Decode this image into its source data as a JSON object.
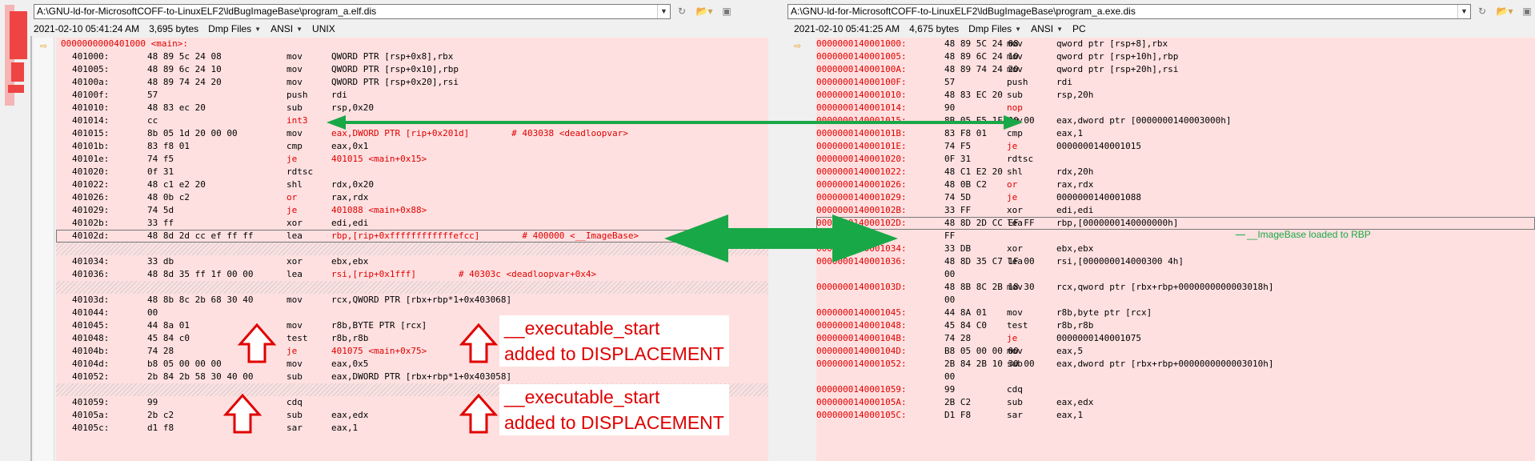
{
  "left": {
    "path": "A:\\GNU-ld-for-MicrosoftCOFF-to-LinuxELF2\\ldBugImageBase\\program_a.elf.dis",
    "date": "2021-02-10 05:41:24 AM",
    "size": "3,695 bytes",
    "filter": "Dmp Files",
    "encoding": "ANSI",
    "eol": "UNIX",
    "header": "0000000000401000 <main>:",
    "lines": [
      [
        "401000:",
        "48 89 5c 24 08",
        "mov",
        "QWORD PTR [rsp+0x8],rbx"
      ],
      [
        "401005:",
        "48 89 6c 24 10",
        "mov",
        "QWORD PTR [rsp+0x10],rbp"
      ],
      [
        "40100a:",
        "48 89 74 24 20",
        "mov",
        "QWORD PTR [rsp+0x20],rsi"
      ],
      [
        "40100f:",
        "57",
        "push",
        "rdi"
      ],
      [
        "401010:",
        "48 83 ec 20",
        "sub",
        "rsp,0x20"
      ],
      [
        "401014:",
        "cc",
        "int3",
        ""
      ],
      [
        "401015:",
        "8b 05 1d 20 00 00",
        "mov",
        "eax,DWORD PTR [rip+0x201d]        # 403038 <deadloopvar>"
      ],
      [
        "40101b:",
        "83 f8 01",
        "cmp",
        "eax,0x1"
      ],
      [
        "40101e:",
        "74 f5",
        "je",
        "401015 <main+0x15>"
      ],
      [
        "401020:",
        "0f 31",
        "rdtsc",
        ""
      ],
      [
        "401022:",
        "48 c1 e2 20",
        "shl",
        "rdx,0x20"
      ],
      [
        "401026:",
        "48 0b c2",
        "or",
        "rax,rdx"
      ],
      [
        "401029:",
        "74 5d",
        "je",
        "401088 <main+0x88>"
      ],
      [
        "40102b:",
        "33 ff",
        "xor",
        "edi,edi"
      ],
      [
        "40102d:",
        "48 8d 2d cc ef ff ff",
        "lea",
        "rbp,[rip+0xffffffffffffefcc]        # 400000 <__ImageBase>"
      ],
      [
        "",
        "",
        "",
        ""
      ],
      [
        "401034:",
        "33 db",
        "xor",
        "ebx,ebx"
      ],
      [
        "401036:",
        "48 8d 35 ff 1f 00 00",
        "lea",
        "rsi,[rip+0x1fff]        # 40303c <deadloopvar+0x4>"
      ],
      [
        "",
        "",
        "",
        ""
      ],
      [
        "40103d:",
        "48 8b 8c 2b 68 30 40",
        "mov",
        "rcx,QWORD PTR [rbx+rbp*1+0x403068]"
      ],
      [
        "401044:",
        "00",
        "",
        ""
      ],
      [
        "401045:",
        "44 8a 01",
        "mov",
        "r8b,BYTE PTR [rcx]"
      ],
      [
        "401048:",
        "45 84 c0",
        "test",
        "r8b,r8b"
      ],
      [
        "40104b:",
        "74 28",
        "je",
        "401075 <main+0x75>"
      ],
      [
        "40104d:",
        "b8 05 00 00 00",
        "mov",
        "eax,0x5"
      ],
      [
        "401052:",
        "2b 84 2b 58 30 40 00",
        "sub",
        "eax,DWORD PTR [rbx+rbp*1+0x403058]"
      ],
      [
        "",
        "",
        "",
        ""
      ],
      [
        "401059:",
        "99",
        "cdq",
        ""
      ],
      [
        "40105a:",
        "2b c2",
        "sub",
        "eax,edx"
      ],
      [
        "40105c:",
        "d1 f8",
        "sar",
        "eax,1"
      ]
    ]
  },
  "right": {
    "path": "A:\\GNU-ld-for-MicrosoftCOFF-to-LinuxELF2\\ldBugImageBase\\program_a.exe.dis",
    "date": "2021-02-10 05:41:25 AM",
    "size": "4,675 bytes",
    "filter": "Dmp Files",
    "encoding": "ANSI",
    "eol": "PC",
    "lines": [
      [
        "0000000140001000:",
        "48 89 5C 24 08",
        "mov",
        "qword ptr [rsp+8],rbx"
      ],
      [
        "0000000140001005:",
        "48 89 6C 24 10",
        "mov",
        "qword ptr [rsp+10h],rbp"
      ],
      [
        "000000014000100A:",
        "48 89 74 24 20",
        "mov",
        "qword ptr [rsp+20h],rsi"
      ],
      [
        "000000014000100F:",
        "57",
        "push",
        "rdi"
      ],
      [
        "0000000140001010:",
        "48 83 EC 20",
        "sub",
        "rsp,20h"
      ],
      [
        "0000000140001014:",
        "90",
        "nop",
        ""
      ],
      [
        "0000000140001015:",
        "8B 05 E5 1F 00 00",
        "mov",
        "eax,dword ptr [0000000140003000h]"
      ],
      [
        "000000014000101B:",
        "83 F8 01",
        "cmp",
        "eax,1"
      ],
      [
        "000000014000101E:",
        "74 F5",
        "je",
        "0000000140001015"
      ],
      [
        "0000000140001020:",
        "0F 31",
        "rdtsc",
        ""
      ],
      [
        "0000000140001022:",
        "48 C1 E2 20",
        "shl",
        "rdx,20h"
      ],
      [
        "0000000140001026:",
        "48 0B C2",
        "or",
        "rax,rdx"
      ],
      [
        "0000000140001029:",
        "74 5D",
        "je",
        "0000000140001088"
      ],
      [
        "000000014000102B:",
        "33 FF",
        "xor",
        "edi,edi"
      ],
      [
        "000000014000102D:",
        "48 8D 2D CC EF FF",
        "lea",
        "rbp,[0000000140000000h]"
      ],
      [
        "",
        "FF",
        "",
        ""
      ],
      [
        "0000000140001034:",
        "33 DB",
        "xor",
        "ebx,ebx"
      ],
      [
        "0000000140001036:",
        "48 8D 35 C7 1F 00",
        "lea",
        "rsi,[000000014000300 4h]"
      ],
      [
        "",
        "00",
        "",
        ""
      ],
      [
        "000000014000103D:",
        "48 8B 8C 2B 18 30",
        "mov",
        "rcx,qword ptr [rbx+rbp+0000000000003018h]"
      ],
      [
        "",
        "00",
        "",
        ""
      ],
      [
        "0000000140001045:",
        "44 8A 01",
        "mov",
        "r8b,byte ptr [rcx]"
      ],
      [
        "0000000140001048:",
        "45 84 C0",
        "test",
        "r8b,r8b"
      ],
      [
        "000000014000104B:",
        "74 28",
        "je",
        "0000000140001075"
      ],
      [
        "000000014000104D:",
        "B8 05 00 00 00",
        "mov",
        "eax,5"
      ],
      [
        "0000000140001052:",
        "2B 84 2B 10 30 00",
        "sub",
        "eax,dword ptr [rbx+rbp+0000000000003010h]"
      ],
      [
        "",
        "00",
        "",
        ""
      ],
      [
        "0000000140001059:",
        "99",
        "cdq",
        ""
      ],
      [
        "000000014000105A:",
        "2B C2",
        "sub",
        "eax,edx"
      ],
      [
        "000000014000105C:",
        "D1 F8",
        "sar",
        "eax,1"
      ]
    ]
  },
  "annotations": {
    "imagebase_note": "__ImageBase loaded to RBP",
    "exec_start_1_l1": "__executable_start",
    "exec_start_1_l2": "added to DISPLACEMENT",
    "exec_start_2_l1": "__executable_start",
    "exec_start_2_l2": "added to DISPLACEMENT"
  },
  "colors": {
    "diff_red": "#e00000",
    "diff_bg": "#ffe0e0",
    "arrow_green": "#19a847"
  }
}
